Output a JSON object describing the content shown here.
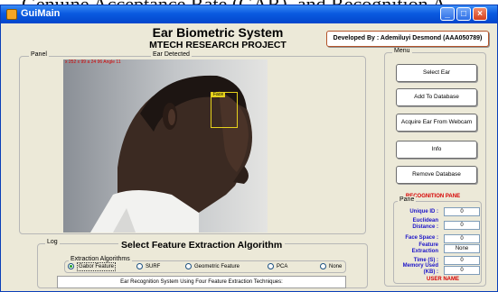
{
  "caption": {
    "text": "Genuine Acceptance Rate (GAR), and Recognition A"
  },
  "window": {
    "title": "GuiMain",
    "buttons": {
      "minimize": "_",
      "maximize": "□",
      "close": "×"
    }
  },
  "header": {
    "title": "Ear Biometric System",
    "subtitle": "MTECH RESEARCH PROJECT",
    "developer": "Developed By : Ademiluyi Desmond (AAA050789)"
  },
  "panel": {
    "label": "Panel",
    "image_caption": "Ear Detected",
    "overlay_text": "x 252 x 99 a 24 96 Angle 11",
    "face_box_label": "Face"
  },
  "menu": {
    "label": "Menu",
    "buttons": [
      "Select Ear",
      "Add To Database",
      "Acquire Ear From Webcam",
      "Info",
      "Remove Database"
    ]
  },
  "recognition": {
    "title": "RECOGNITION PANE",
    "pane_label": "Pane",
    "fields": [
      {
        "label": "Unique ID :",
        "value": "0"
      },
      {
        "label": "Euclidean Distance :",
        "value": "0"
      },
      {
        "label": "Face Space :",
        "value": "0"
      },
      {
        "label": "Feature Extraction",
        "value": "None"
      },
      {
        "label": "Time (S) :",
        "value": "0"
      },
      {
        "label": "Memory Used (KB) :",
        "value": "0"
      }
    ],
    "user_name": "USER NAME"
  },
  "log": {
    "label": "Log",
    "title": "Select Feature Extraction Algorithm",
    "algorithms_label": "Extraction Algorithms",
    "algorithms": [
      "Gabor Feature",
      "SURF",
      "Geometric Feature",
      "PCA",
      "None"
    ],
    "selected": "Gabor Feature",
    "status": "Ear Recognition System Using Four Feature Extraction Techniques:"
  },
  "colors": {
    "titlebar": "#0a5ae0",
    "window_bg": "#ece9d8",
    "pane_label": "#1c14c8",
    "pane_title": "#d60000",
    "face_box": "#e6d21c"
  }
}
